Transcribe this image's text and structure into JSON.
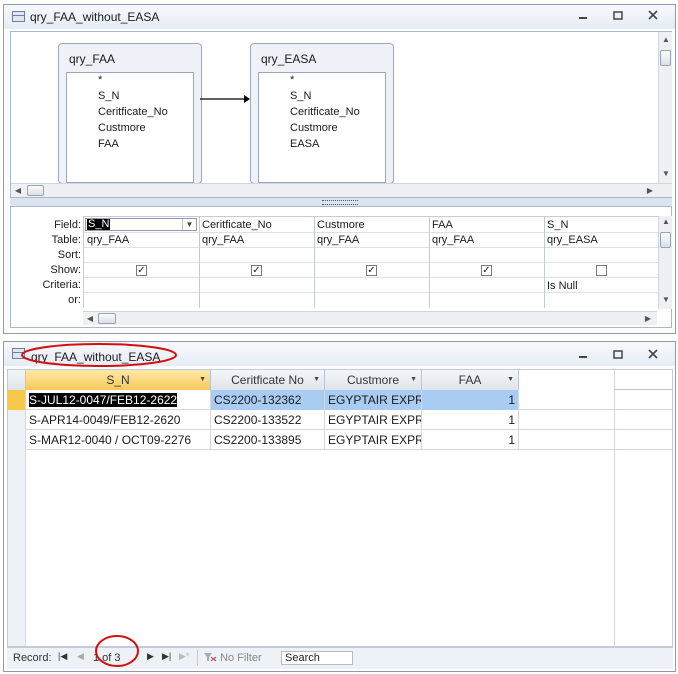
{
  "query_window": {
    "title": "qry_FAA_without_EASA",
    "buttons": {
      "minimize": "▭",
      "restore": "▢",
      "close": "✕"
    },
    "tables": [
      {
        "name": "qry_FAA",
        "fields": [
          "*",
          "S_N",
          "Ceritficate_No",
          "Custmore",
          "FAA"
        ]
      },
      {
        "name": "qry_EASA",
        "fields": [
          "*",
          "S_N",
          "Ceritficate_No",
          "Custmore",
          "EASA"
        ]
      }
    ],
    "grid": {
      "row_labels": {
        "field": "Field:",
        "table": "Table:",
        "sort": "Sort:",
        "show": "Show:",
        "criteria": "Criteria:",
        "or": "or:"
      },
      "columns": [
        {
          "field": "S_N",
          "table": "qry_FAA",
          "show": true,
          "criteria": ""
        },
        {
          "field": "Ceritficate_No",
          "table": "qry_FAA",
          "show": true,
          "criteria": ""
        },
        {
          "field": "Custmore",
          "table": "qry_FAA",
          "show": true,
          "criteria": ""
        },
        {
          "field": "FAA",
          "table": "qry_FAA",
          "show": true,
          "criteria": ""
        },
        {
          "field": "S_N",
          "table": "qry_EASA",
          "show": false,
          "criteria": "Is Null"
        }
      ]
    }
  },
  "datasheet_window": {
    "title": "qry_FAA_without_EASA",
    "buttons": {
      "minimize": "▭",
      "restore": "▢",
      "close": "✕"
    },
    "columns": [
      "S_N",
      "Ceritficate No",
      "Custmore",
      "FAA"
    ],
    "rows": [
      [
        "S-JUL12-0047/FEB12-2622",
        "CS2200-132362",
        "EGYPTAIR EXPR",
        "1"
      ],
      [
        "S-APR14-0049/FEB12-2620",
        "CS2200-133522",
        "EGYPTAIR EXPR",
        "1"
      ],
      [
        "S-MAR12-0040 / OCT09-2276",
        "CS2200-133895",
        "EGYPTAIR EXPR",
        "1"
      ]
    ],
    "record_nav": {
      "label": "Record:",
      "position": "1 of 3",
      "filter_label": "No Filter",
      "search_placeholder": "Search"
    }
  },
  "colors": {
    "selected_row": "#f5c94e",
    "highlight_cell": "#a9cdf2",
    "annotation": "#d01010"
  }
}
